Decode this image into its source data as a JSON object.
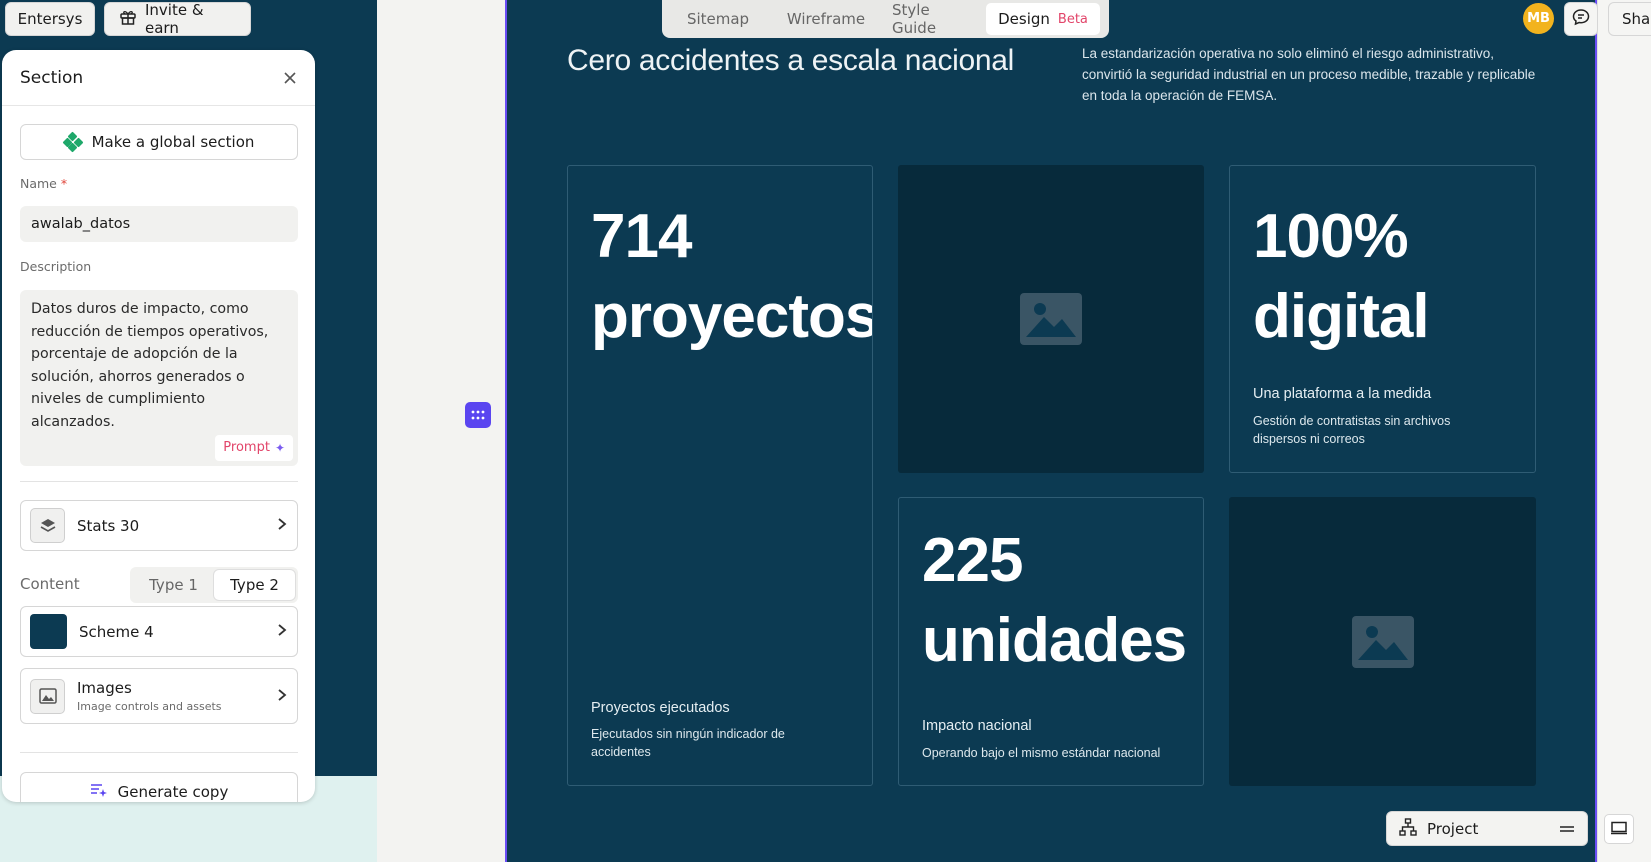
{
  "topbar": {
    "workspace_label": "Entersys",
    "invite_label": "Invite & earn"
  },
  "panel": {
    "title": "Section",
    "global_button": "Make a global section",
    "name_label": "Name",
    "name_required_mark": "*",
    "name_value": "awalab_datos",
    "description_label": "Description",
    "description_value": "Datos duros de impacto, como reducción de tiempos operativos, porcentaje de adopción de la solución, ahorros generados o niveles de cumplimiento alcanzados.",
    "prompt_label": "Prompt",
    "layout_row": {
      "label": "Stats 30"
    },
    "content_label": "Content",
    "content_types": [
      "Type 1",
      "Type 2"
    ],
    "content_selected": "Type 2",
    "scheme_row": {
      "label": "Scheme 4",
      "swatch_color": "#0c3a52"
    },
    "images_row": {
      "label": "Images",
      "sublabel": "Image controls and assets"
    },
    "generate_button": "Generate copy"
  },
  "tabs": {
    "items": [
      "Sitemap",
      "Wireframe",
      "Style Guide",
      "Design"
    ],
    "active": "Design",
    "badge": "Beta"
  },
  "header_right": {
    "avatar_initials": "MB",
    "share_label": "Sha"
  },
  "canvas": {
    "background": "#0c3a52",
    "title": "Cero accidentes a escala nacional",
    "lead": "La estandarización operativa no solo eliminó el riesgo administrativo, convirtió la seguridad industrial en un proceso medible, trazable y replicable en toda la operación de FEMSA.",
    "stats": [
      {
        "number_line1": "714",
        "number_line2": "proyectos",
        "heading": "Proyectos ejecutados",
        "description": "Ejecutados sin ningún indicador de accidentes"
      },
      {
        "number_line1": "100%",
        "number_line2": "digital",
        "heading": "Una plataforma a la medida",
        "description": "Gestión de contratistas sin archivos dispersos ni correos"
      },
      {
        "number_line1": "225",
        "number_line2": "unidades",
        "heading": "Impacto nacional",
        "description": "Operando bajo el mismo estándar nacional"
      }
    ]
  },
  "bottom": {
    "project_label": "Project"
  },
  "colors": {
    "accent": "#5a45f0",
    "brand_green": "#1ea86a",
    "avatar": "#f2b31e",
    "beta": "#e2456a"
  }
}
